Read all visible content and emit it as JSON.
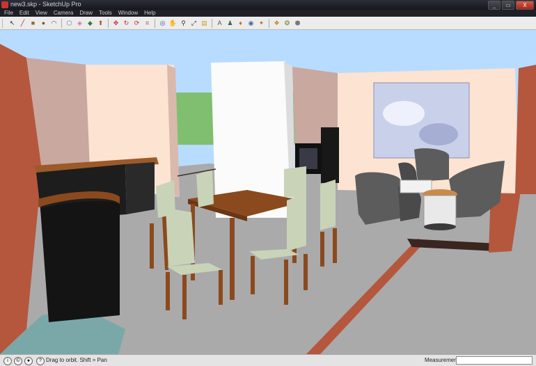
{
  "window": {
    "title": "new3.skp - SketchUp Pro",
    "buttons": [
      "_",
      "▭",
      "X"
    ]
  },
  "menu": [
    "File",
    "Edit",
    "View",
    "Camera",
    "Draw",
    "Tools",
    "Window",
    "Help"
  ],
  "toolbar": {
    "tools": [
      {
        "name": "select-tool-icon",
        "glyph": "↖",
        "color": "#222"
      },
      {
        "name": "line-tool-icon",
        "glyph": "╱",
        "color": "#b02020"
      },
      {
        "name": "rectangle-tool-icon",
        "glyph": "■",
        "color": "#8a6a3a"
      },
      {
        "name": "circle-tool-icon",
        "glyph": "●",
        "color": "#7a5a2a"
      },
      {
        "name": "arc-tool-icon",
        "glyph": "◠",
        "color": "#444"
      },
      {
        "name": "make-component-icon",
        "glyph": "⬡",
        "color": "#777"
      },
      {
        "name": "eraser-tool-icon",
        "glyph": "◈",
        "color": "#d070a0"
      },
      {
        "name": "paint-bucket-icon",
        "glyph": "◆",
        "color": "#3a7a3a"
      },
      {
        "name": "push-pull-icon",
        "glyph": "⬆",
        "color": "#a84a2a"
      },
      {
        "name": "move-tool-icon",
        "glyph": "✥",
        "color": "#c03030"
      },
      {
        "name": "rotate-tool-icon",
        "glyph": "↻",
        "color": "#c03030"
      },
      {
        "name": "follow-me-icon",
        "glyph": "⟳",
        "color": "#b03030"
      },
      {
        "name": "offset-tool-icon",
        "glyph": "⌗",
        "color": "#9a3030"
      },
      {
        "name": "orbit-tool-icon",
        "glyph": "◎",
        "color": "#2a5aa0"
      },
      {
        "name": "pan-tool-icon",
        "glyph": "✋",
        "color": "#444"
      },
      {
        "name": "zoom-tool-icon",
        "glyph": "⚲",
        "color": "#333"
      },
      {
        "name": "zoom-extents-icon",
        "glyph": "⤢",
        "color": "#333"
      },
      {
        "name": "tape-measure-icon",
        "glyph": "▤",
        "color": "#c8a020"
      },
      {
        "name": "text-tool-icon",
        "glyph": "A",
        "color": "#555"
      },
      {
        "name": "position-camera-icon",
        "glyph": "♟",
        "color": "#3a6a3a"
      },
      {
        "name": "walk-tool-icon",
        "glyph": "♦",
        "color": "#c07020"
      },
      {
        "name": "look-around-icon",
        "glyph": "◉",
        "color": "#3a6aa0"
      },
      {
        "name": "section-plane-icon",
        "glyph": "✦",
        "color": "#c07020"
      },
      {
        "name": "get-models-icon",
        "glyph": "❖",
        "color": "#c08020"
      },
      {
        "name": "share-model-icon",
        "glyph": "❂",
        "color": "#6a8a3a"
      },
      {
        "name": "components-icon",
        "glyph": "⬢",
        "color": "#777"
      }
    ]
  },
  "status": {
    "hint": "Drag to orbit. Shift = Pan",
    "measurements_label": "Measurements",
    "measurements_value": ""
  },
  "colors": {
    "sky": "#b8dcff",
    "grass": "#7fbf6f",
    "floor": "#aaaaaa",
    "wall_light": "#fde3d2",
    "wall_shadow": "#c9a8a0",
    "wall_accent": "#b5573d",
    "wood": "#8b4a1e",
    "upholstery": "#c8d3b8",
    "sofa": "#5c5c5c"
  }
}
